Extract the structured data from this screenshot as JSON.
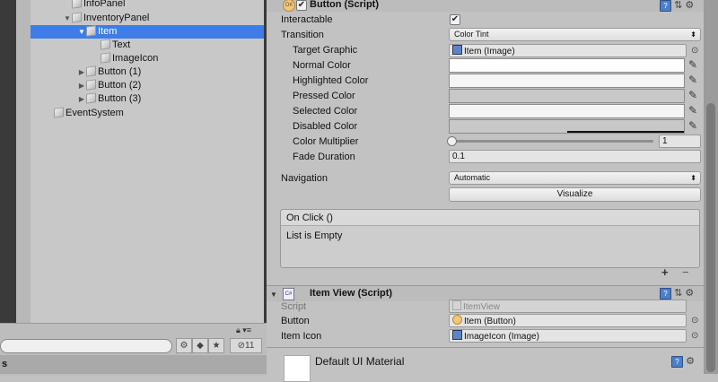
{
  "hierarchy": {
    "items": [
      {
        "label": "InfoPanel",
        "arrow": ""
      },
      {
        "label": "InventoryPanel",
        "arrow": "▼"
      },
      {
        "label": "Item",
        "arrow": "▼"
      },
      {
        "label": "Text",
        "arrow": ""
      },
      {
        "label": "ImageIcon",
        "arrow": ""
      },
      {
        "label": "Button (1)",
        "arrow": "▶"
      },
      {
        "label": "Button (2)",
        "arrow": "▶"
      },
      {
        "label": "Button (3)",
        "arrow": "▶"
      },
      {
        "label": "EventSystem",
        "arrow": ""
      }
    ]
  },
  "project": {
    "header": "s",
    "hidden_count": "11"
  },
  "button_component": {
    "title": "Button (Script)",
    "interactable_label": "Interactable",
    "interactable_checked": "✔",
    "transition_label": "Transition",
    "transition_value": "Color Tint",
    "target_graphic_label": "Target Graphic",
    "target_graphic_value": "Item (Image)",
    "normal_color_label": "Normal Color",
    "highlighted_color_label": "Highlighted Color",
    "pressed_color_label": "Pressed Color",
    "selected_color_label": "Selected Color",
    "disabled_color_label": "Disabled Color",
    "color_multiplier_label": "Color Multiplier",
    "color_multiplier_value": "1",
    "fade_duration_label": "Fade Duration",
    "fade_duration_value": "0.1",
    "navigation_label": "Navigation",
    "navigation_value": "Automatic",
    "visualize_label": "Visualize",
    "onclick_label": "On Click ()",
    "onclick_empty": "List is Empty",
    "plus": "+",
    "minus": "−",
    "icon_ok": "OK"
  },
  "itemview_component": {
    "title": "Item View (Script)",
    "script_label": "Script",
    "script_value": "ItemView",
    "button_label": "Button",
    "button_value": "Item (Button)",
    "itemicon_label": "Item Icon",
    "itemicon_value": "ImageIcon (Image)",
    "icon_cs": "C#"
  },
  "material": {
    "title": "Default UI Material"
  },
  "colors": {
    "selection": "#3e7de8",
    "panel": "#c2c2c2"
  }
}
